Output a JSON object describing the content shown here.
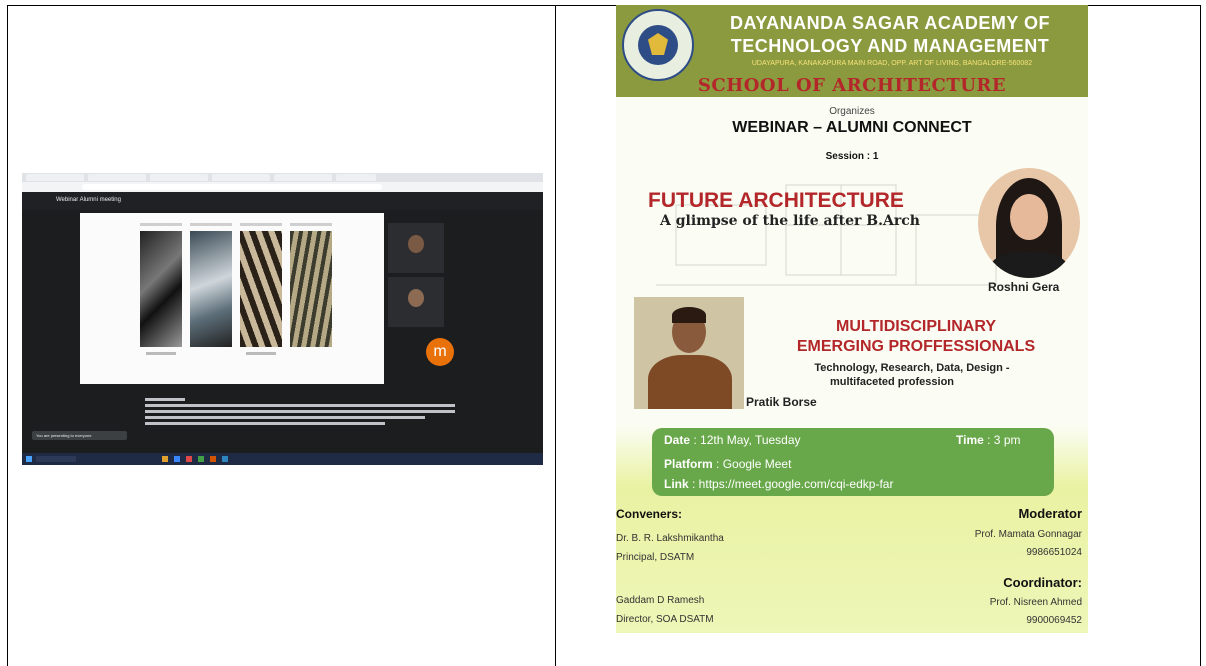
{
  "meeting_screenshot": {
    "meeting_title": "Webinar Alumni meeting",
    "present_button_label": "You are presenting to everyone",
    "participant_initial": "m"
  },
  "poster": {
    "college_line1": "DAYANANDA SAGAR ACADEMY OF",
    "college_line2": "TECHNOLOGY AND MANAGEMENT",
    "address": "UDAYAPURA, KANAKAPURA MAIN ROAD, OPP. ART OF LIVING, BANGALORE-560082",
    "school": "SCHOOL OF ARCHITECTURE",
    "organizes": "Organizes",
    "webinar_title": "WEBINAR – ALUMNI CONNECT",
    "session": "Session : 1",
    "talk1_title": "FUTURE ARCHITECTURE",
    "talk1_subtitle": "A glimpse of the life  after B.Arch",
    "speaker1": "Roshni Gera",
    "talk2_title_line1": "MULTIDISCIPLINARY",
    "talk2_title_line2": "EMERGING PROFFESSIONALS",
    "talk2_subtitle_line1": "Technology, Research, Data, Design  -",
    "talk2_subtitle_line2": "multifaceted profession",
    "speaker2": "Pratik Borse",
    "date_label": "Date",
    "date_value": ": 12th May, Tuesday",
    "time_label": "Time",
    "time_value": ": 3 pm",
    "platform_label": "Platform",
    "platform_value": ": Google Meet",
    "link_label": "Link",
    "link_value": ": https://meet.google.com/cqi-edkp-far",
    "conveners_heading": "Conveners:",
    "convener1_name": "Dr. B. R. Lakshmikantha",
    "convener1_role": "Principal, DSATM",
    "convener2_name": "Gaddam D Ramesh",
    "convener2_role": "Director, SOA DSATM",
    "moderator_heading": "Moderator",
    "moderator_name": "Prof. Mamata Gonnagar",
    "moderator_phone": "9986651024",
    "coordinator_heading": "Coordinator:",
    "coordinator_name": "Prof. Nisreen Ahmed",
    "coordinator_phone": "9900069452"
  },
  "colors": {
    "header_olive": "#8b9a3e",
    "title_red": "#b3272a",
    "info_green": "#69a84a",
    "footer_yellow": "#e9f2a2"
  }
}
